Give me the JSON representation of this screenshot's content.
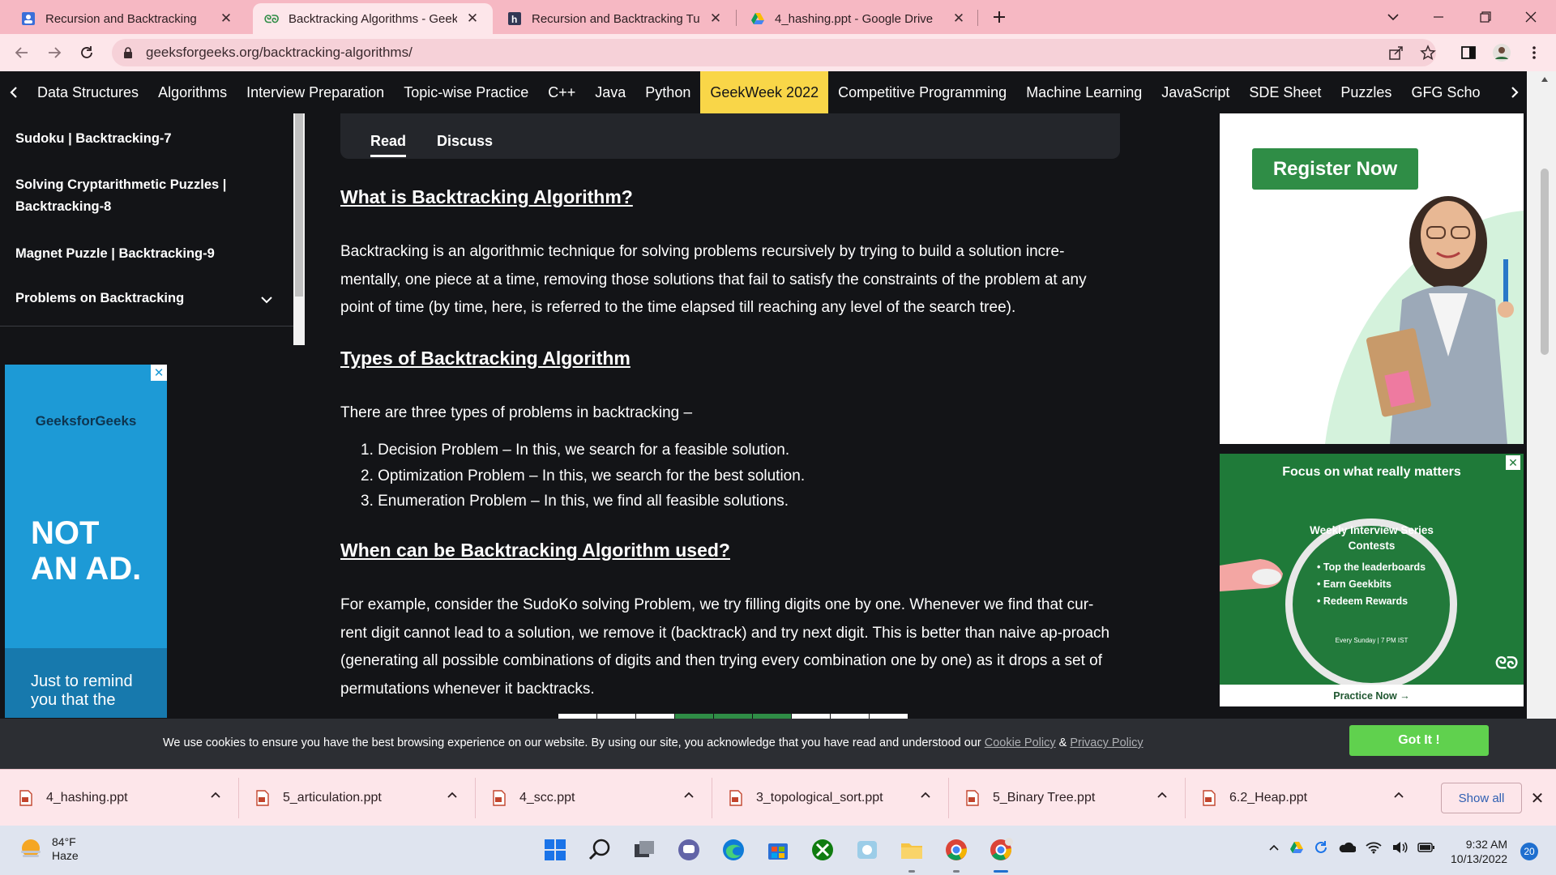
{
  "browser": {
    "tabs": [
      {
        "title": "Recursion and Backtracking",
        "favicon": "student-icon"
      },
      {
        "title": "Backtracking Algorithms - GeeksforGeeks",
        "favicon": "gfg-icon"
      },
      {
        "title": "Recursion and Backtracking Tutorials",
        "favicon": "hackerearth-icon"
      },
      {
        "title": "4_hashing.ppt - Google Drive",
        "favicon": "google-drive-icon"
      }
    ],
    "url": "geeksforgeeks.org/backtracking-algorithms/"
  },
  "site_nav": {
    "items": [
      "Data Structures",
      "Algorithms",
      "Interview Preparation",
      "Topic-wise Practice",
      "C++",
      "Java",
      "Python",
      "GeekWeek 2022",
      "Competitive Programming",
      "Machine Learning",
      "JavaScript",
      "SDE Sheet",
      "Puzzles",
      "GFG Scho"
    ],
    "highlight_color": "#f9d648"
  },
  "sidebar": {
    "items": [
      {
        "label": "Sudoku | Backtracking-7"
      },
      {
        "label": "Solving Cryptarithmetic Puzzles | Backtracking-8"
      },
      {
        "label": "Magnet Puzzle | Backtracking-9"
      },
      {
        "label": "Problems on Backtracking"
      }
    ]
  },
  "left_ad": {
    "brand": "GeeksforGeeks",
    "headline_1": "NOT",
    "headline_2": "AN AD.",
    "remind": "Just to remind you that the"
  },
  "article": {
    "tabs": {
      "read": "Read",
      "discuss": "Discuss"
    },
    "h_what": "What is Backtracking Algorithm?",
    "p_what": "Backtracking is an algorithmic technique for solving problems recursively by trying to build a solution incre-mentally, one piece at a time, removing those solutions that fail to satisfy the constraints of the problem at any point of time (by time, here, is referred to the time elapsed till reaching any level of the search tree).",
    "h_types": "Types of Backtracking Algorithm",
    "p_types": "There are three types of problems in backtracking –",
    "list": [
      "1. Decision Problem – In this, we search for a feasible solution.",
      "2. Optimization Problem – In this, we search for the best solution.",
      "3. Enumeration Problem – In this, we find all feasible solutions."
    ],
    "h_when": "When can be Backtracking Algorithm used?",
    "p_when": "For example, consider the SudoKo solving Problem, we try filling digits one by one. Whenever we find that cur-rent digit cannot lead to a solution, we remove it (backtrack) and try next digit. This is better than naive ap-proach (generating all possible combinations of digits and then trying every combination one by one) as it drops a set of permutations whenever it backtracks."
  },
  "right_ads": {
    "register_label": "Register Now",
    "focus_title": "Focus on what really matters",
    "circle_title": "Weekly Interview Series Contests",
    "circle_items": [
      "Top the leaderboards",
      "Earn Geekbits",
      "Redeem Rewards"
    ],
    "circle_sub": "Every Sunday | 7 PM IST",
    "logo": "ᘓᘐ",
    "practice": "Practice Now →"
  },
  "cookie": {
    "text": "We use cookies to ensure you have the best browsing experience on our website. By using our site, you acknowledge that you have read and understood our ",
    "cookie_policy": "Cookie Policy",
    "amp": " & ",
    "privacy_policy": "Privacy Policy",
    "button": "Got It !"
  },
  "downloads": {
    "files": [
      "4_hashing.ppt",
      "5_articulation.ppt",
      "4_scc.ppt",
      "3_topological_sort.ppt",
      "5_Binary Tree.ppt",
      "6.2_Heap.ppt"
    ],
    "show_all": "Show all"
  },
  "taskbar": {
    "temp": "84°F",
    "condition": "Haze",
    "time": "9:32 AM",
    "date": "10/13/2022",
    "notifications": "20"
  },
  "colors": {
    "gfg_green": "#2f8d46",
    "chrome_pink": "#f6b8c3",
    "page_bg": "#131417"
  }
}
